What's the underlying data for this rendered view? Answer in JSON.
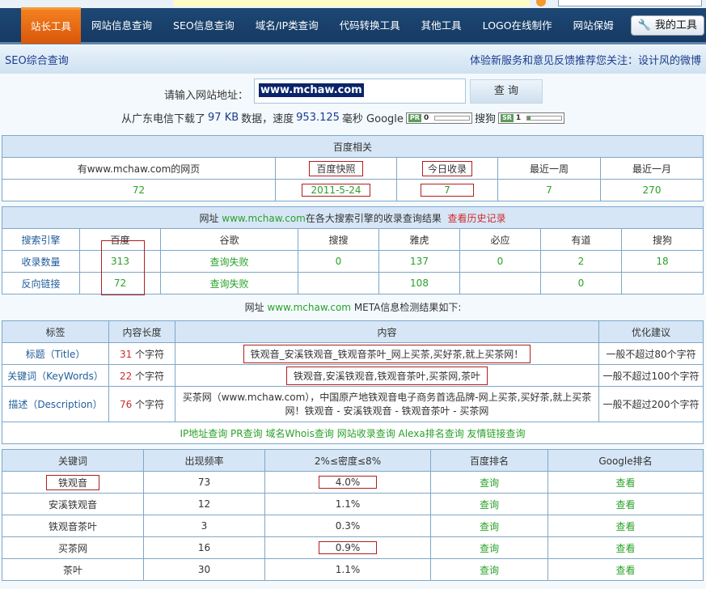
{
  "nav": {
    "items": [
      "站长工具",
      "网站信息查询",
      "SEO信息查询",
      "域名/IP类查询",
      "代码转换工具",
      "其他工具",
      "LOGO在线制作",
      "网站保姆"
    ],
    "active_index": 0,
    "my_tools": "我的工具"
  },
  "subbar": {
    "title": "SEO综合查询",
    "notice": "体验新服务和意见反馈推荐您关注：设计风的微博"
  },
  "query": {
    "label": "请输入网站地址：",
    "input_value": "www.mchaw.com",
    "button": "查 询",
    "stats_prefix": "从广东电信下载了",
    "size": "97 KB",
    "stats_mid": "数据，速度",
    "speed": "953.125",
    "stats_unit": "毫秒 Google",
    "google_tag": "PR",
    "google_value": "0",
    "google_fraction": 0,
    "sogou_label": "搜狗",
    "sogou_tag": "SR",
    "sogou_value": "1",
    "sogou_fraction": 0.1
  },
  "baidu": {
    "title": "百度相关",
    "headers": [
      "有www.mchaw.com的网页",
      "百度快照",
      "今日收录",
      "最近一周",
      "最近一月"
    ],
    "values": [
      "72",
      "2011-5-24",
      "7",
      "7",
      "270"
    ]
  },
  "engines": {
    "title_prefix": "网址",
    "title_domain": "www.mchaw.com",
    "title_suffix": "在各大搜索引擎的收录查询结果",
    "history_link": "查看历史记录",
    "headers": [
      "搜索引擎",
      "百度",
      "谷歌",
      "搜搜",
      "雅虎",
      "必应",
      "有道",
      "搜狗"
    ],
    "rows": [
      [
        "收录数量",
        "313",
        "查询失败",
        "0",
        "137",
        "0",
        "2",
        "18"
      ],
      [
        "反向链接",
        "72",
        "查询失败",
        "",
        "108",
        "",
        "0",
        ""
      ]
    ]
  },
  "meta": {
    "caption_prefix": "网址",
    "caption_domain": "www.mchaw.com",
    "caption_suffix": "META信息检测结果如下:",
    "headers": [
      "标签",
      "内容长度",
      "内容",
      "优化建议"
    ],
    "rows": [
      {
        "tag": "标题（Title）",
        "len": "31",
        "unit": "个字符",
        "content": "铁观音_安溪铁观音_铁观音茶叶_网上买茶,买好茶,就上买茶网！",
        "advice": "一般不超过80个字符"
      },
      {
        "tag": "关键词（KeyWords）",
        "len": "22",
        "unit": "个字符",
        "content": "铁观音,安溪铁观音,铁观音茶叶,买茶网,茶叶",
        "advice": "一般不超过100个字符"
      },
      {
        "tag": "描述（Description）",
        "len": "76",
        "unit": "个字符",
        "content": "买茶网（www.mchaw.com），中国原产地铁观音电子商务首选品牌-网上买茶,买好茶,就上买茶网！铁观音 - 安溪铁观音 - 铁观音茶叶 - 买茶网",
        "advice": "一般不超过200个字符"
      }
    ],
    "links": [
      "IP地址查询",
      "PR查询",
      "域名Whois查询",
      "网站收录查询",
      "Alexa排名查询",
      "友情链接查询"
    ]
  },
  "keywords": {
    "headers": [
      "关键词",
      "出现频率",
      "2%≤密度≤8%",
      "百度排名",
      "Google排名"
    ],
    "rows": [
      {
        "word": "铁观音",
        "freq": "73",
        "density": "4.0%",
        "baidu": "查询",
        "google": "查看"
      },
      {
        "word": "安溪铁观音",
        "freq": "12",
        "density": "1.1%",
        "baidu": "查询",
        "google": "查看"
      },
      {
        "word": "铁观音茶叶",
        "freq": "3",
        "density": "0.3%",
        "baidu": "查询",
        "google": "查看"
      },
      {
        "word": "买茶网",
        "freq": "16",
        "density": "0.9%",
        "baidu": "查询",
        "google": "查看"
      },
      {
        "word": "茶叶",
        "freq": "30",
        "density": "1.1%",
        "baidu": "查询",
        "google": "查看"
      }
    ]
  }
}
